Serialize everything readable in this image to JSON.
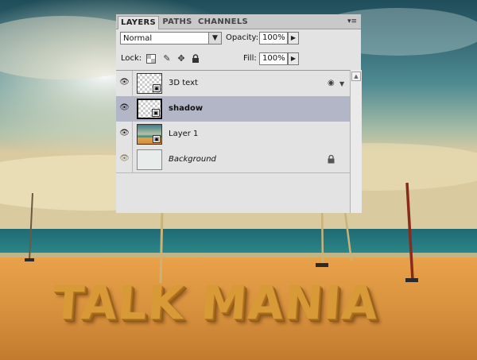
{
  "panel": {
    "tabs": [
      "LAYERS",
      "PATHS",
      "CHANNELS"
    ],
    "menu_icon": "panel-menu-icon",
    "blend_mode": "Normal",
    "opacity_label": "Opacity:",
    "opacity_value": "100%",
    "lock_label": "Lock:",
    "fill_label": "Fill:",
    "fill_value": "100%",
    "layers": [
      {
        "name": "3D text",
        "selected": false,
        "thumb": "checker-smart-object",
        "right_icons": [
          "light-icon",
          "expand-arrow-icon"
        ]
      },
      {
        "name": "shadow",
        "selected": true,
        "thumb": "checker-smart-object"
      },
      {
        "name": "Layer 1",
        "selected": false,
        "thumb": "photo"
      },
      {
        "name": "Background",
        "selected": false,
        "thumb": "plain",
        "right_icons": [
          "lock-icon"
        ]
      }
    ]
  },
  "canvas": {
    "text": "TALK MANIA"
  }
}
